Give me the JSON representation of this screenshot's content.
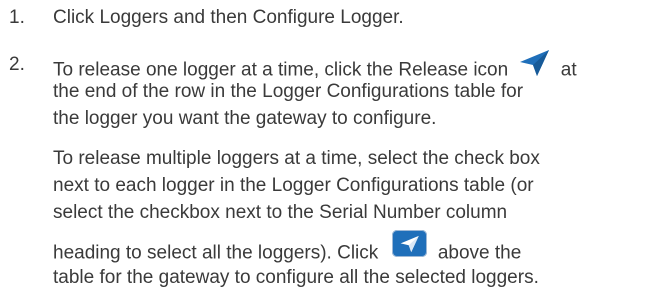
{
  "steps": [
    {
      "number": "1.",
      "text": "Click Loggers and then Configure Logger."
    },
    {
      "number": "2.",
      "para1_line1_pre": "To release one logger at a time, click the Release icon",
      "para1_line1_post": "at",
      "para1_line2": "the end of the row in the Logger Configurations table for",
      "para1_line3": "the logger you want the gateway to configure.",
      "para2_line1": "To release multiple loggers at a time, select the check box",
      "para2_line2": "next to each logger in the Logger Configurations table (or",
      "para2_line3": "select the checkbox next to the Serial Number column",
      "para2_line4_pre": "heading to select all the loggers). Click",
      "para2_line4_post": "above the",
      "para2_line5": "table for the gateway to configure all the selected loggers."
    }
  ],
  "icons": {
    "release_inline": "paper-plane-icon",
    "release_button": "paper-plane-icon",
    "release_color": "#1f6fba"
  }
}
